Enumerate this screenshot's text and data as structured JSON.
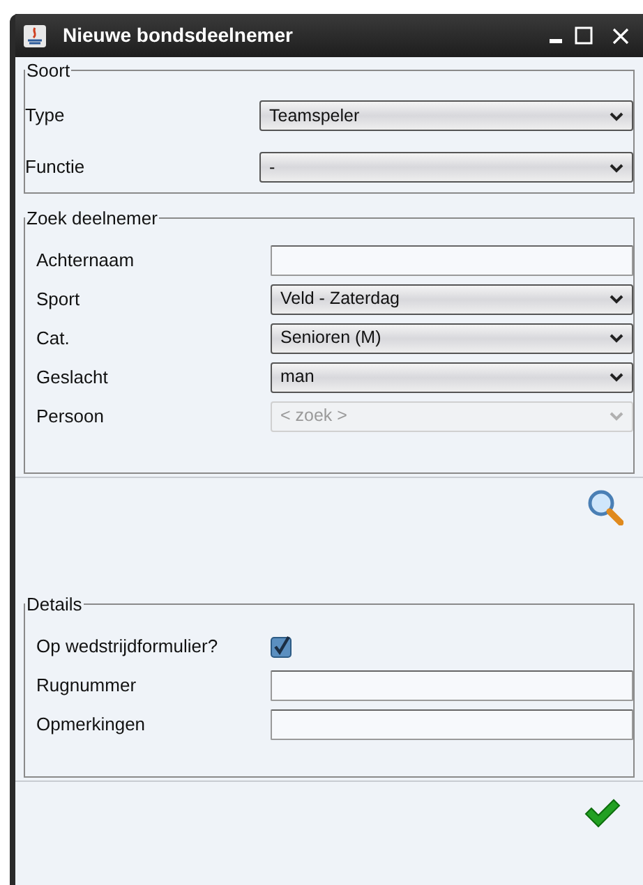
{
  "window": {
    "title": "Nieuwe bondsdeelnemer"
  },
  "sections": [
    {
      "legend": "Soort",
      "rows": [
        {
          "kind": "select",
          "label": "Type",
          "value": "Teamspeler",
          "disabled": false
        },
        {
          "kind": "select",
          "label": "Functie",
          "value": "-",
          "disabled": false
        }
      ]
    },
    {
      "legend": "Zoek deelnemer",
      "rows": [
        {
          "kind": "text",
          "label": "Achternaam"
        },
        {
          "kind": "select",
          "label": "Sport",
          "value": "Veld - Zaterdag",
          "disabled": false
        },
        {
          "kind": "select",
          "label": "Cat.",
          "value": "Senioren (M)",
          "disabled": false
        },
        {
          "kind": "select",
          "label": "Geslacht",
          "value": "man",
          "disabled": false
        },
        {
          "kind": "select",
          "label": "Persoon",
          "value": "< zoek >",
          "disabled": true
        }
      ]
    },
    {
      "legend": "Details",
      "rows": [
        {
          "kind": "checkbox",
          "label": "Op wedstrijdformulier?",
          "checked": true
        },
        {
          "kind": "text",
          "label": "Rugnummer"
        },
        {
          "kind": "text",
          "label": "Opmerkingen"
        }
      ]
    }
  ]
}
